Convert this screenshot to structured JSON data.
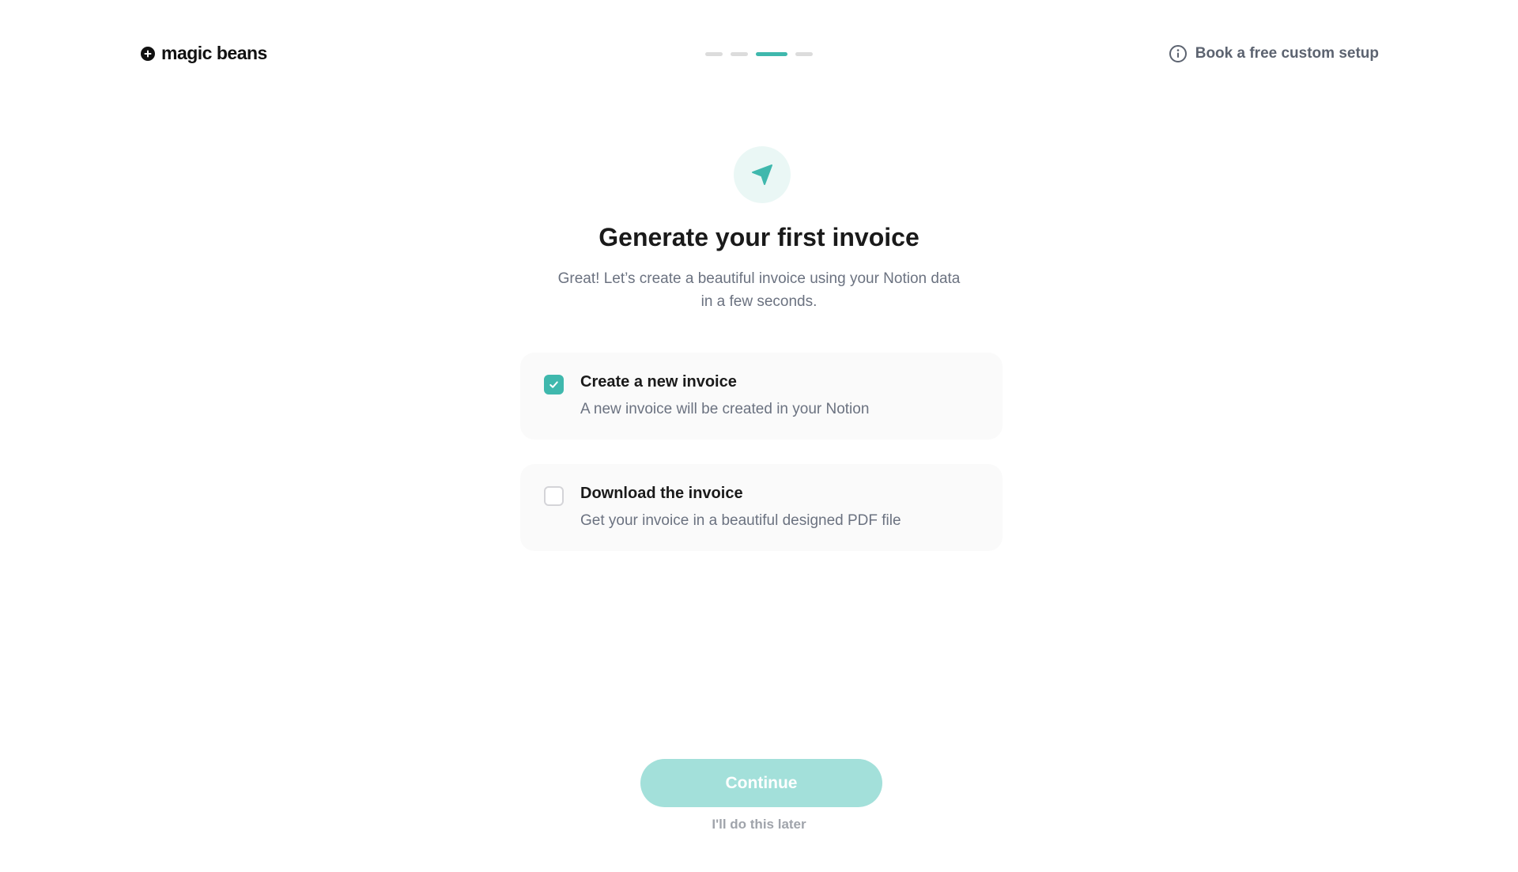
{
  "header": {
    "brand": "magic beans",
    "logo_icon": "plus-circle-icon",
    "stepper": {
      "total_steps": 4,
      "current_step": 3
    },
    "help_link": {
      "label": "Book a free custom setup",
      "icon": "info-icon"
    }
  },
  "hero": {
    "icon": "paper-plane-icon",
    "title": "Generate your first invoice",
    "subtitle_line1": "Great! Let’s create a beautiful invoice using your Notion data",
    "subtitle_line2": "in a few seconds."
  },
  "options": [
    {
      "title": "Create a new invoice",
      "description": "A new invoice will be created in your Notion",
      "checked": true
    },
    {
      "title": "Download the invoice",
      "description": "Get your invoice in a beautiful designed PDF file",
      "checked": false
    }
  ],
  "actions": {
    "continue_label": "Continue",
    "skip_label": "I'll do this later"
  },
  "colors": {
    "accent": "#3fb8ad",
    "accent_light": "#a3e0da",
    "icon_bg": "#eaf7f5",
    "card_bg": "#fafafa",
    "muted_text": "#6b7280"
  }
}
